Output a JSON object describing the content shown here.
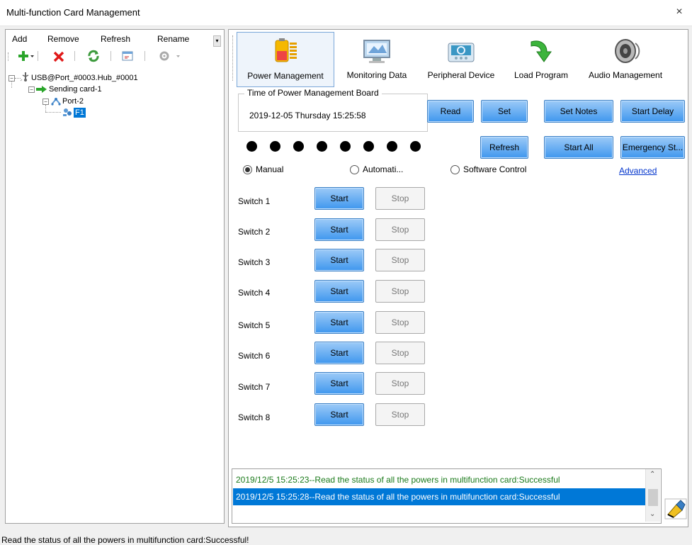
{
  "window": {
    "title": "Multi-function Card Management",
    "close": "×"
  },
  "left": {
    "menu": [
      "Add",
      "Remove",
      "Refresh",
      "Rename"
    ],
    "tree": {
      "root": "USB@Port_#0003.Hub_#0001",
      "sending_card": "Sending card-1",
      "port": "Port-2",
      "card": "F1"
    }
  },
  "tabs": [
    "Power Management",
    "Monitoring Data",
    "Peripheral Device",
    "Load Program",
    "Audio Management"
  ],
  "power": {
    "group_title": "Time of Power Management Board",
    "datetime": "2019-12-05 Thursday 15:25:58",
    "read_label": "Read",
    "set_label": "Set",
    "set_notes_label": "Set Notes",
    "start_delay_label": "Start Delay",
    "refresh_label": "Refresh",
    "start_all_label": "Start All",
    "emergency_label": "Emergency St...",
    "modes": [
      "Manual",
      "Automati...",
      "Software Control"
    ],
    "selected_mode": "Manual",
    "advanced_label": "Advanced",
    "switches": [
      {
        "label": "Switch 1",
        "start": "Start",
        "stop": "Stop"
      },
      {
        "label": "Switch 2",
        "start": "Start",
        "stop": "Stop"
      },
      {
        "label": "Switch 3",
        "start": "Start",
        "stop": "Stop"
      },
      {
        "label": "Switch 4",
        "start": "Start",
        "stop": "Stop"
      },
      {
        "label": "Switch 5",
        "start": "Start",
        "stop": "Stop"
      },
      {
        "label": "Switch 6",
        "start": "Start",
        "stop": "Stop"
      },
      {
        "label": "Switch 7",
        "start": "Start",
        "stop": "Stop"
      },
      {
        "label": "Switch 8",
        "start": "Start",
        "stop": "Stop"
      }
    ]
  },
  "log": [
    {
      "text": "2019/12/5 15:25:23--Read the status of all the powers in multifunction card:Successful",
      "color": "#1a7a1a"
    },
    {
      "text": "2019/12/5 15:25:28--Read the status of all the powers in multifunction card:Successful",
      "color": "#ffffff",
      "selected": true
    }
  ],
  "status": "Read the status of all the powers in multifunction card:Successful!",
  "colors": {
    "accent": "#0078d7",
    "log_green": "#1a7a1a",
    "link": "#0033cc"
  }
}
